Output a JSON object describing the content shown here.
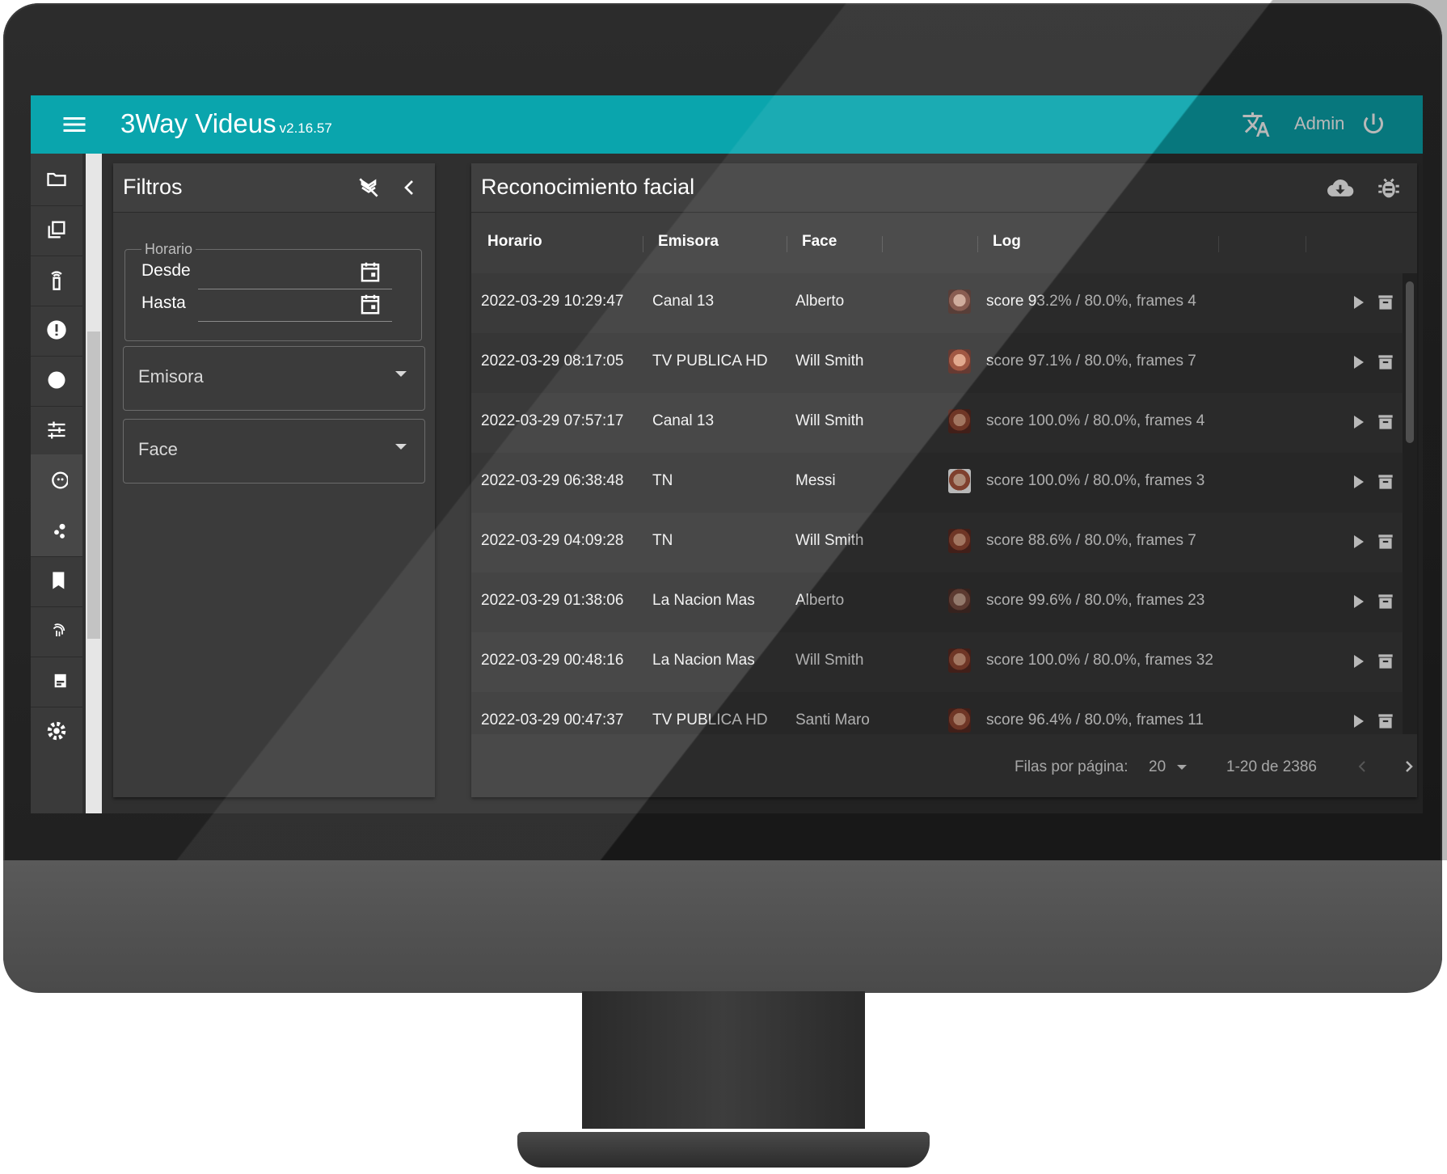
{
  "app": {
    "title": "3Way Videus",
    "version": "v2.16.57",
    "user": "Admin",
    "accent": "#0aa5ad"
  },
  "rail": {
    "icons": [
      "folder-icon",
      "library-icon",
      "remote-icon",
      "alert-icon",
      "record-icon",
      "tune-icon",
      "face-icon",
      "scatter-icon",
      "book-icon",
      "fingerprint-icon",
      "subtitles-icon",
      "settings-icon"
    ]
  },
  "filters": {
    "title": "Filtros",
    "horario_legend": "Horario",
    "desde_label": "Desde",
    "hasta_label": "Hasta",
    "emisora_label": "Emisora",
    "face_label": "Face"
  },
  "main": {
    "title": "Reconocimiento facial",
    "columns": [
      "Horario",
      "Emisora",
      "Face",
      "",
      "Log"
    ],
    "rows": [
      {
        "horario": "2022-03-29 10:29:47",
        "emisora": "Canal 13",
        "face": "Alberto",
        "log": "score 93.2% / 80.0%, frames 4"
      },
      {
        "horario": "2022-03-29 08:17:05",
        "emisora": "TV PUBLICA HD",
        "face": "Will Smith",
        "log": "score 97.1% / 80.0%, frames 7"
      },
      {
        "horario": "2022-03-29 07:57:17",
        "emisora": "Canal 13",
        "face": "Will Smith",
        "log": "score 100.0% / 80.0%, frames 4"
      },
      {
        "horario": "2022-03-29 06:38:48",
        "emisora": "TN",
        "face": "Messi",
        "log": "score 100.0% / 80.0%, frames 3"
      },
      {
        "horario": "2022-03-29 04:09:28",
        "emisora": "TN",
        "face": "Will Smith",
        "log": "score 88.6% / 80.0%, frames 7"
      },
      {
        "horario": "2022-03-29 01:38:06",
        "emisora": "La Nacion Mas",
        "face": "Alberto",
        "log": "score 99.6% / 80.0%, frames 23"
      },
      {
        "horario": "2022-03-29 00:48:16",
        "emisora": "La Nacion Mas",
        "face": "Will Smith",
        "log": "score 100.0% / 80.0%, frames 32"
      },
      {
        "horario": "2022-03-29 00:47:37",
        "emisora": "TV PUBLICA HD",
        "face": "Santi Maro",
        "log": "score 96.4% / 80.0%, frames 11"
      }
    ]
  },
  "pager": {
    "rows_per_page_label": "Filas por página:",
    "rows_per_page": "20",
    "range": "1-20 de 2386"
  }
}
